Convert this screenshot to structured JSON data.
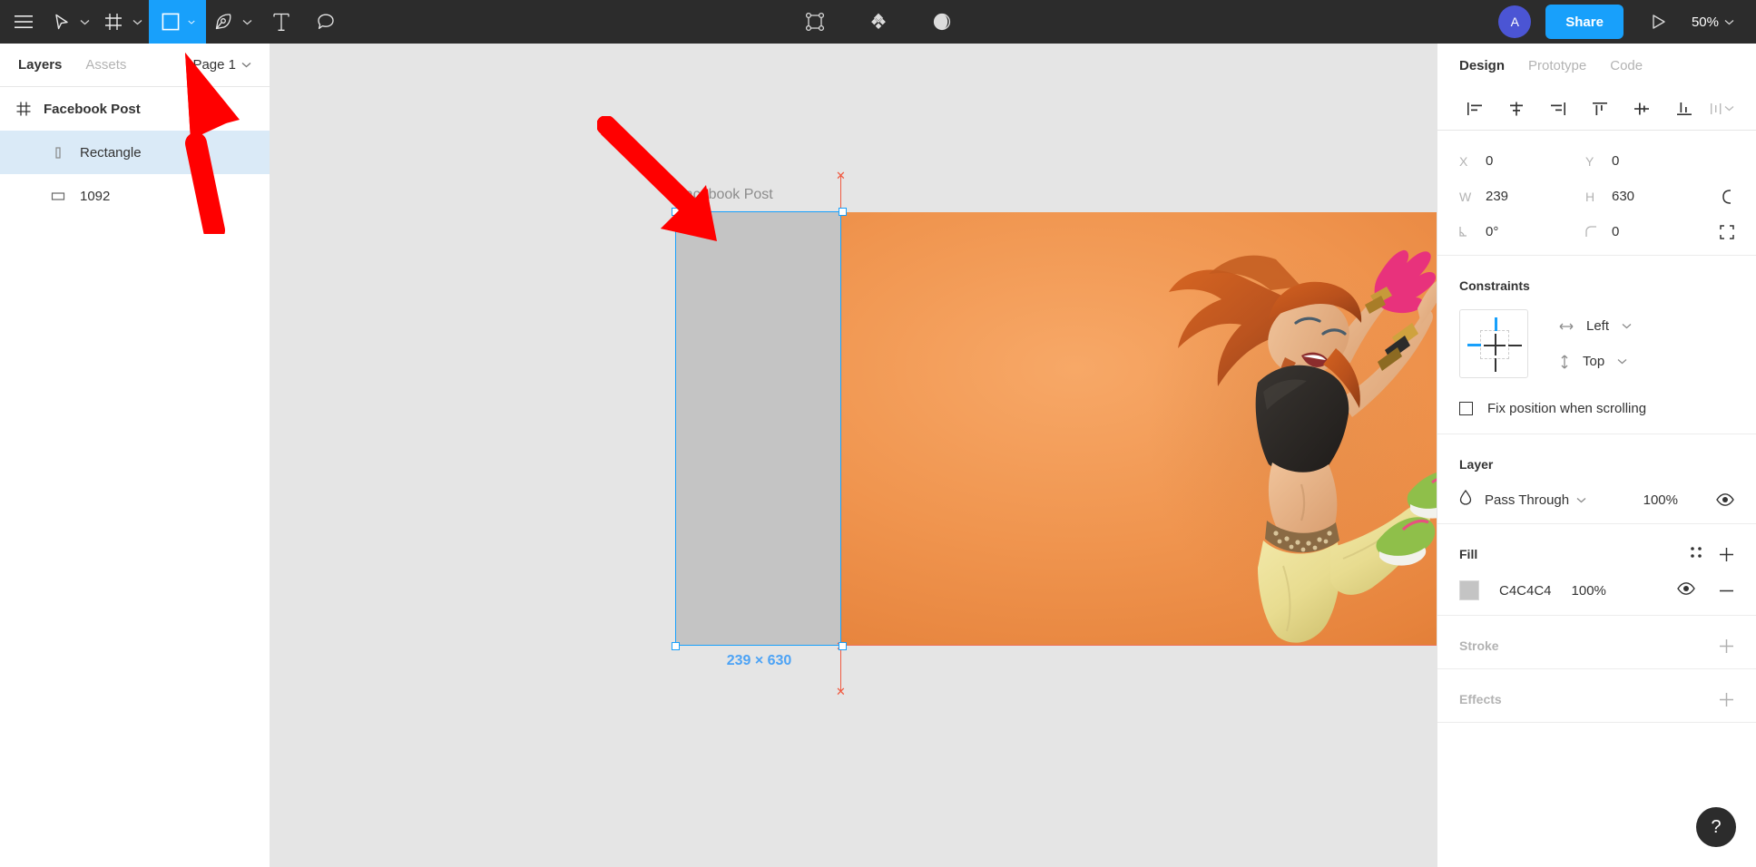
{
  "toolbar": {
    "menu_icon": "hamburger-menu-icon",
    "tools": [
      {
        "name": "move-tool",
        "icon": "cursor-arrow-icon",
        "has_chevron": true,
        "active": false
      },
      {
        "name": "frame-tool",
        "icon": "frame-grid-icon",
        "has_chevron": true,
        "active": false
      },
      {
        "name": "shape-tool",
        "icon": "square-icon",
        "has_chevron": true,
        "active": true
      },
      {
        "name": "pen-tool",
        "icon": "pen-nib-icon",
        "has_chevron": true,
        "active": false
      },
      {
        "name": "text-tool",
        "icon": "text-t-icon",
        "has_chevron": false,
        "active": false
      },
      {
        "name": "comment-tool",
        "icon": "speech-bubble-icon",
        "has_chevron": false,
        "active": false
      }
    ],
    "center_tools": [
      {
        "name": "scale-tool",
        "icon": "bounding-box-nodes-icon"
      },
      {
        "name": "components-tool",
        "icon": "four-diamonds-icon"
      },
      {
        "name": "mask-tool",
        "icon": "half-moon-contrast-icon"
      }
    ],
    "avatar_initial": "A",
    "share_label": "Share",
    "present_icon": "play-triangle-icon",
    "zoom_level": "50%",
    "accent_color": "#18a0fb"
  },
  "left_panel": {
    "tabs": [
      {
        "label": "Layers",
        "active": true
      },
      {
        "label": "Assets",
        "active": false
      }
    ],
    "page_selector": "Page 1",
    "layers": [
      {
        "name": "Facebook Post",
        "icon": "frame-icon",
        "depth": 0,
        "selected": false
      },
      {
        "name": "Rectangle",
        "icon": "narrow-rectangle-icon",
        "depth": 1,
        "selected": true
      },
      {
        "name": "1092",
        "icon": "image-rectangle-icon",
        "depth": 1,
        "selected": false
      }
    ]
  },
  "canvas": {
    "frame_label": "Facebook Post",
    "selection_dimensions": "239 × 630",
    "selection_color": "#18a0fb",
    "measure_color": "#f05a41",
    "rect_fill": "#C4C4C4",
    "photo_background": "#f0954f",
    "annotations": [
      {
        "name": "arrow-to-shape-tool",
        "color": "#ff0000",
        "direction": "up"
      },
      {
        "name": "arrow-to-rectangle",
        "color": "#ff0000",
        "direction": "down-right"
      }
    ]
  },
  "right_panel": {
    "tabs": [
      {
        "label": "Design",
        "active": true
      },
      {
        "label": "Prototype",
        "active": false
      },
      {
        "label": "Code",
        "active": false
      }
    ],
    "align_buttons": [
      {
        "name": "align-left-icon"
      },
      {
        "name": "align-horizontal-center-icon"
      },
      {
        "name": "align-right-icon"
      },
      {
        "name": "align-top-icon"
      },
      {
        "name": "align-vertical-center-icon"
      },
      {
        "name": "align-bottom-icon"
      },
      {
        "name": "distribute-more-icon"
      }
    ],
    "properties": {
      "x_label": "X",
      "x_value": "0",
      "y_label": "Y",
      "y_value": "0",
      "w_label": "W",
      "w_value": "239",
      "h_label": "H",
      "h_value": "630",
      "rotation_value": "0°",
      "corner_radius_value": "0"
    },
    "constraints": {
      "title": "Constraints",
      "horizontal": "Left",
      "vertical": "Top",
      "fix_position_label": "Fix position when scrolling",
      "fix_position_checked": false,
      "active_color": "#18a0fb"
    },
    "layer": {
      "title": "Layer",
      "blend_mode": "Pass Through",
      "opacity": "100%"
    },
    "fill": {
      "title": "Fill",
      "color_hex": "C4C4C4",
      "opacity": "100%",
      "swatch_color": "#C4C4C4"
    },
    "stroke": {
      "title": "Stroke"
    },
    "effects": {
      "title": "Effects"
    }
  },
  "help_button": {
    "label": "?"
  }
}
